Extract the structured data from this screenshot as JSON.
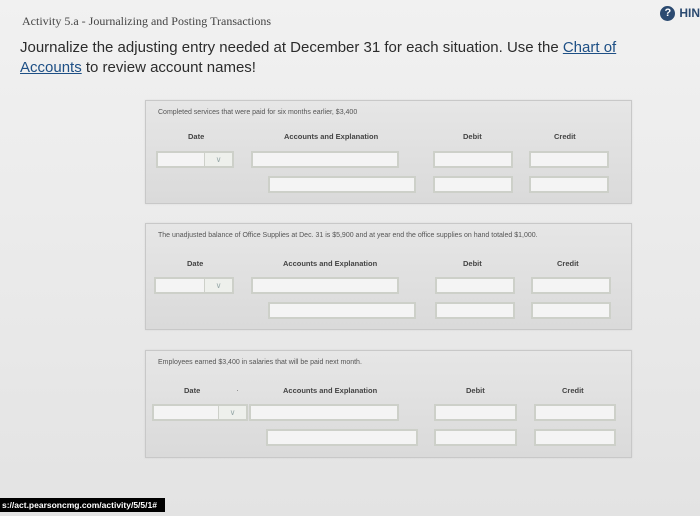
{
  "hint": {
    "icon": "?",
    "label": "HIN"
  },
  "header": {
    "activity_title": "Activity 5.a - Journalizing and Posting Transactions"
  },
  "instruction": {
    "text_before": "Journalize the adjusting entry needed at December 31 for each situation. Use the",
    "link_text": "Chart of Accounts",
    "text_after": "to review account names!"
  },
  "columns": {
    "date": "Date",
    "accounts": "Accounts and Explanation",
    "debit": "Debit",
    "credit": "Credit"
  },
  "entries": [
    {
      "scenario": "Completed services that were paid for six months earlier, $3,400"
    },
    {
      "scenario": "The unadjusted balance of Office Supplies at Dec. 31 is $5,900 and at year end the office supplies on hand totaled $1,000."
    },
    {
      "scenario": "Employees earned $3,400 in salaries that will be paid next month."
    }
  ],
  "status_bar": {
    "url": "s://act.pearsoncmg.com/activity/5/5/1#"
  }
}
